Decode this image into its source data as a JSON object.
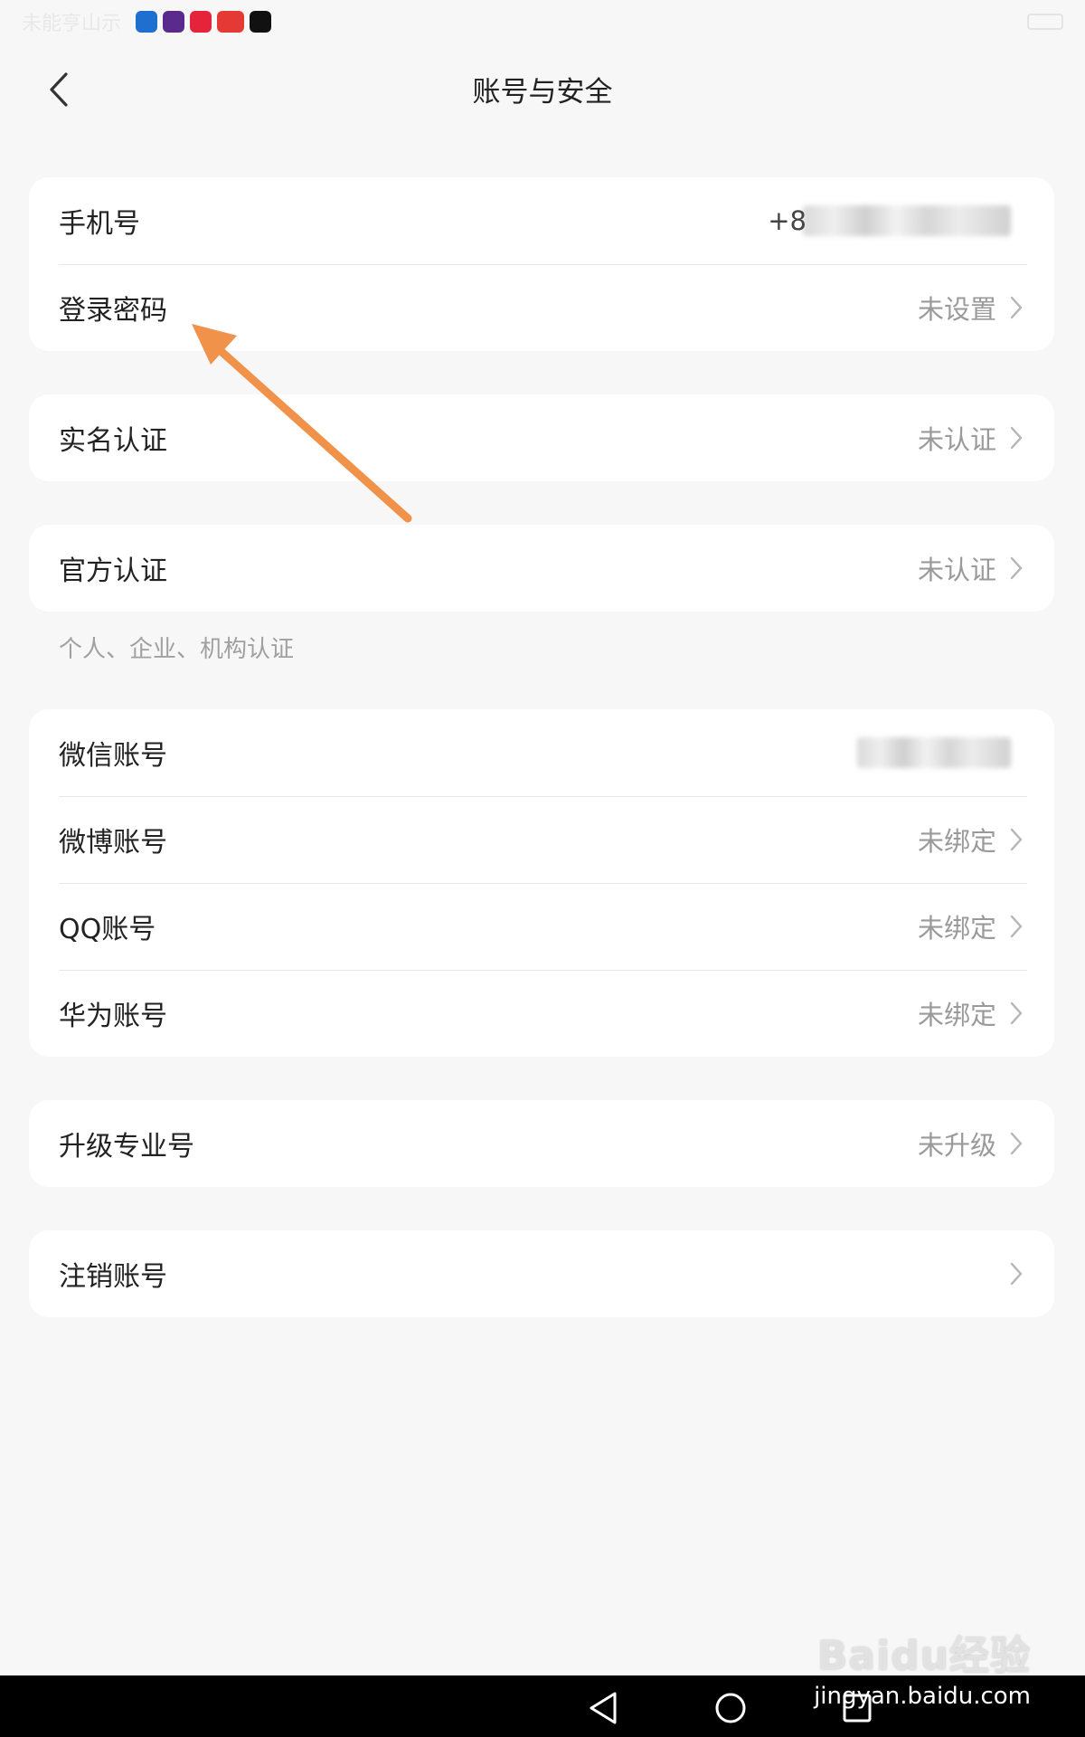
{
  "statusbar": {
    "left_text": "未能亨山示",
    "app_icons": [
      {
        "name": "shield-app-icon",
        "color": "#1f6fd1"
      },
      {
        "name": "play-app-icon",
        "color": "#5a2a8c"
      },
      {
        "name": "xiaohongshu-app-icon",
        "color": "#e5233a"
      },
      {
        "name": "toutiao-app-icon",
        "color": "#e53935"
      },
      {
        "name": "capcut-app-icon",
        "color": "#111111"
      }
    ]
  },
  "header": {
    "title": "账号与安全"
  },
  "groups": {
    "account": {
      "phone": {
        "label": "手机号",
        "prefix": "+8"
      },
      "password": {
        "label": "登录密码",
        "value": "未设置"
      }
    },
    "realname": {
      "label": "实名认证",
      "value": "未认证"
    },
    "official": {
      "label": "官方认证",
      "value": "未认证",
      "hint": "个人、企业、机构认证"
    },
    "bindings": {
      "wechat": {
        "label": "微信账号"
      },
      "weibo": {
        "label": "微博账号",
        "value": "未绑定"
      },
      "qq": {
        "label": "QQ账号",
        "value": "未绑定"
      },
      "huawei": {
        "label": "华为账号",
        "value": "未绑定"
      }
    },
    "upgrade": {
      "label": "升级专业号",
      "value": "未升级"
    },
    "cancel": {
      "label": "注销账号"
    }
  },
  "annotation": {
    "arrow_color": "#f0924a"
  },
  "watermark": {
    "logo": "Baidu经验",
    "url": "jingyan.baidu.com"
  },
  "colors": {
    "background": "#f7f7f7",
    "card": "#ffffff",
    "secondary_text": "#9a9a9a"
  }
}
